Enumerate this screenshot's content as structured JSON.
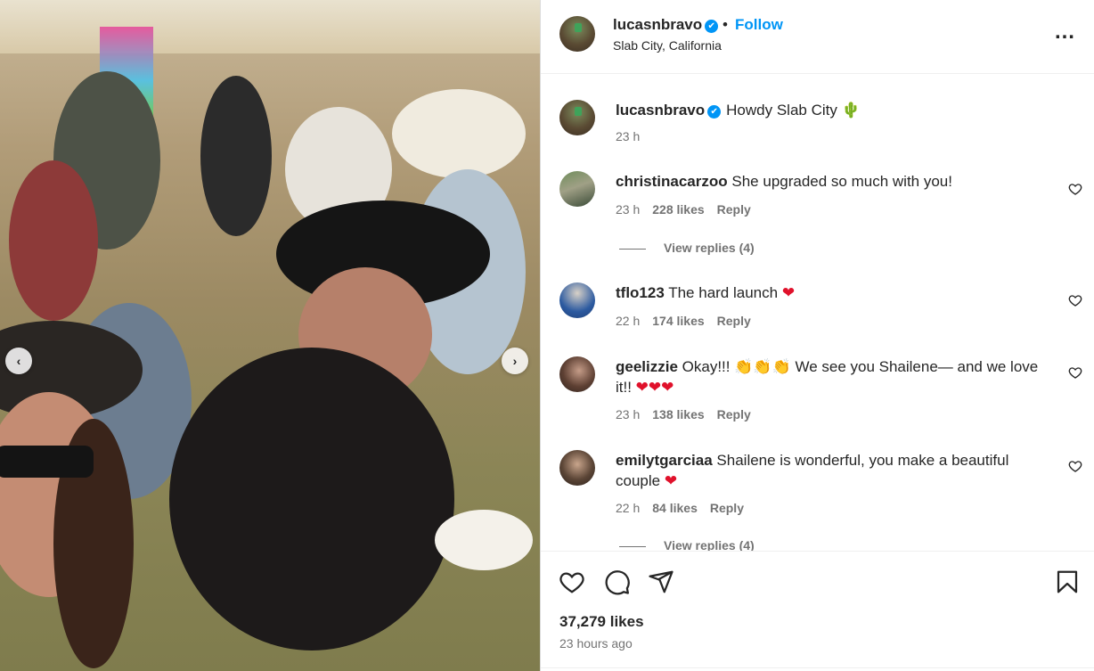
{
  "post": {
    "username": "lucasnbravo",
    "verified_mark": "✔",
    "separator": "•",
    "follow_label": "Follow",
    "location": "Slab City, California",
    "more_icon": "…"
  },
  "caption": {
    "username": "lucasnbravo",
    "text": "Howdy Slab City 🌵",
    "time": "23 h"
  },
  "comments": [
    {
      "username": "christinacarzoo",
      "text": "She upgraded so much with you!",
      "time": "23 h",
      "likes": "228 likes",
      "reply_label": "Reply",
      "view_replies": "View replies (4)"
    },
    {
      "username": "tflo123",
      "text": "The hard launch ❤",
      "time": "22 h",
      "likes": "174 likes",
      "reply_label": "Reply"
    },
    {
      "username": "geelizzie",
      "text": "Okay!!! 👏👏👏 We see you Shailene— and we love it!! ❤❤❤",
      "time": "23 h",
      "likes": "138 likes",
      "reply_label": "Reply"
    },
    {
      "username": "emilytgarciaa",
      "text": "Shailene is wonderful, you make a beautiful couple ❤",
      "time": "22 h",
      "likes": "84 likes",
      "reply_label": "Reply",
      "view_replies": "View replies (4)"
    }
  ],
  "photo_nav": {
    "prev": "‹",
    "next": "›"
  },
  "footer": {
    "likes": "37,279 likes",
    "time_ago": "23 hours ago"
  },
  "icons": {
    "like": "heart-icon",
    "comment": "comment-icon",
    "share": "share-icon",
    "save": "bookmark-icon"
  },
  "colors": {
    "accent": "#0095f6",
    "heart": "#e0112b",
    "muted": "#737373"
  }
}
